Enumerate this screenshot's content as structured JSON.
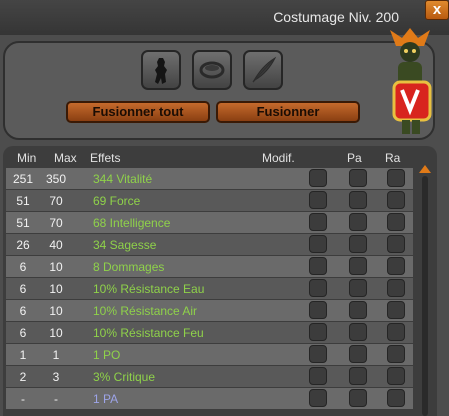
{
  "window": {
    "title": "Costumage Niv. 200",
    "close_glyph": "x"
  },
  "slots": [
    {
      "icon": "figure-icon"
    },
    {
      "icon": "ring-icon"
    },
    {
      "icon": "feather-icon"
    }
  ],
  "buttons": {
    "merge_all": "Fusionner tout",
    "merge": "Fusionner"
  },
  "table": {
    "headers": {
      "min": "Min",
      "max": "Max",
      "effects": "Effets",
      "modif": "Modif.",
      "pa": "Pa",
      "ra": "Ra"
    },
    "rows": [
      {
        "min": "251",
        "max": "350",
        "effect": "344 Vitalité",
        "kind": "stat"
      },
      {
        "min": "51",
        "max": "70",
        "effect": "69 Force",
        "kind": "stat"
      },
      {
        "min": "51",
        "max": "70",
        "effect": "68 Intelligence",
        "kind": "stat"
      },
      {
        "min": "26",
        "max": "40",
        "effect": "34 Sagesse",
        "kind": "stat"
      },
      {
        "min": "6",
        "max": "10",
        "effect": "8 Dommages",
        "kind": "stat"
      },
      {
        "min": "6",
        "max": "10",
        "effect": "10% Résistance Eau",
        "kind": "stat"
      },
      {
        "min": "6",
        "max": "10",
        "effect": "10% Résistance Air",
        "kind": "stat"
      },
      {
        "min": "6",
        "max": "10",
        "effect": "10% Résistance Feu",
        "kind": "stat"
      },
      {
        "min": "1",
        "max": "1",
        "effect": "1 PO",
        "kind": "stat"
      },
      {
        "min": "2",
        "max": "3",
        "effect": "3% Critique",
        "kind": "stat"
      },
      {
        "min": "-",
        "max": "-",
        "effect": "1 PA",
        "kind": "pa"
      }
    ]
  },
  "colors": {
    "effect_green": "#8fd24a",
    "effect_blue": "#9da4e8",
    "accent_orange": "#c56a2c"
  }
}
